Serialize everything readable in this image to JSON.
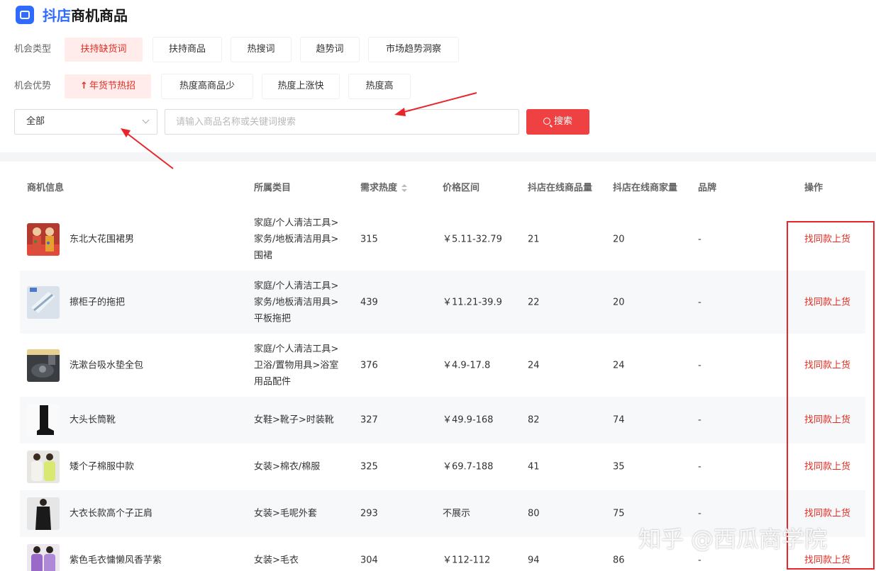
{
  "app": {
    "title_brand": "抖店",
    "title_rest": "商机商品"
  },
  "filters": {
    "type_label": "机会类型",
    "type_chips": [
      "扶持缺货词",
      "扶持商品",
      "热搜词",
      "趋势词",
      "市场趋势洞察"
    ],
    "adv_label": "机会优势",
    "adv_chips": [
      "年货节热招",
      "热度高商品少",
      "热度上涨快",
      "热度高"
    ]
  },
  "search": {
    "select_value": "全部",
    "placeholder": "请输入商品名称或关键词搜索",
    "button_label": "搜索"
  },
  "table": {
    "headers": [
      "商机信息",
      "所属类目",
      "需求热度",
      "价格区间",
      "抖店在线商品量",
      "抖店在线商家量",
      "品牌",
      "操作"
    ],
    "rows": [
      {
        "name": "东北大花围裙男",
        "cat1": "家庭/个人清洁工具>",
        "cat2": "家务/地板清洁用具>",
        "cat3": "围裙",
        "heat": "315",
        "price": "￥5.11-32.79",
        "products": "21",
        "merchants": "20",
        "brand": "-",
        "action": "找同款上货"
      },
      {
        "name": "擦柜子的拖把",
        "cat1": "家庭/个人清洁工具>",
        "cat2": "家务/地板清洁用具>",
        "cat3": "平板拖把",
        "heat": "439",
        "price": "￥11.21-39.9",
        "products": "22",
        "merchants": "20",
        "brand": "-",
        "action": "找同款上货"
      },
      {
        "name": "洗漱台吸水垫全包",
        "cat1": "家庭/个人清洁工具>",
        "cat2": "卫浴/置物用具>浴室",
        "cat3": "用品配件",
        "heat": "376",
        "price": "￥4.9-17.8",
        "products": "24",
        "merchants": "24",
        "brand": "-",
        "action": "找同款上货"
      },
      {
        "name": "大头长筒靴",
        "cat1": "女鞋>靴子>时装靴",
        "heat": "327",
        "price": "￥49.9-168",
        "products": "82",
        "merchants": "74",
        "brand": "-",
        "action": "找同款上货"
      },
      {
        "name": "矮个子棉服中款",
        "cat1": "女装>棉衣/棉服",
        "heat": "325",
        "price": "￥69.7-188",
        "products": "41",
        "merchants": "35",
        "brand": "-",
        "action": "找同款上货"
      },
      {
        "name": "大衣长款高个子正肩",
        "cat1": "女装>毛呢外套",
        "heat": "293",
        "price": "不展示",
        "products": "80",
        "merchants": "75",
        "brand": "-",
        "action": "找同款上货"
      },
      {
        "name": "紫色毛衣慵懒风香芋紫",
        "cat1": "女装>毛衣",
        "heat": "304",
        "price": "￥112-112",
        "products": "94",
        "merchants": "86",
        "brand": "-",
        "action": "找同款上货"
      }
    ]
  },
  "watermark": "知乎 @西瓜商学院",
  "colors": {
    "accent": "#f04142",
    "brand_blue": "#2f6bff",
    "annotation_red": "#e8252a"
  }
}
